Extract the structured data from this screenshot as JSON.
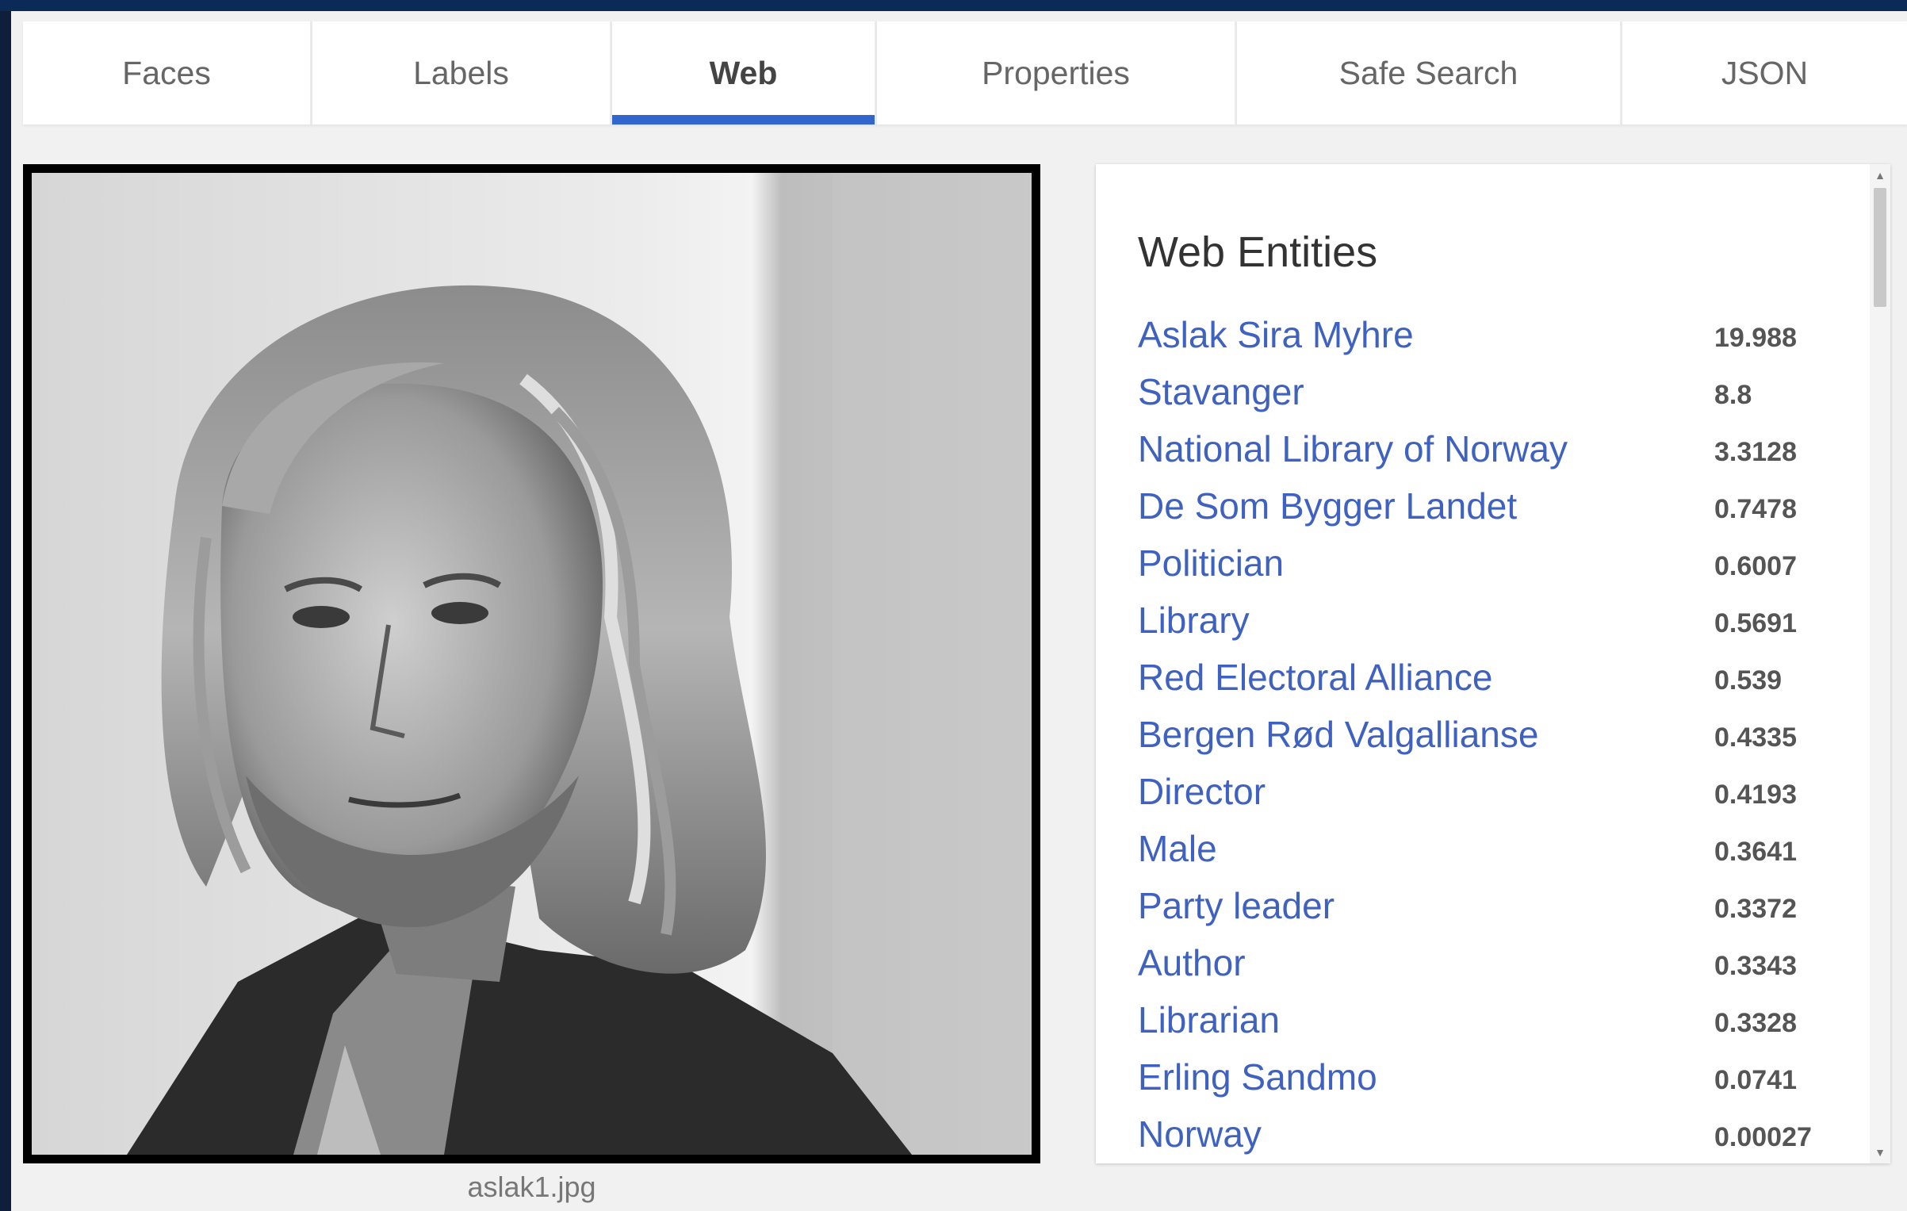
{
  "tabs": [
    {
      "label": "Faces",
      "active": false
    },
    {
      "label": "Labels",
      "active": false
    },
    {
      "label": "Web",
      "active": true
    },
    {
      "label": "Properties",
      "active": false
    },
    {
      "label": "Safe Search",
      "active": false
    },
    {
      "label": "JSON",
      "active": false
    }
  ],
  "image": {
    "caption": "aslak1.jpg"
  },
  "web_entities": {
    "title": "Web Entities",
    "items": [
      {
        "name": "Aslak Sira Myhre",
        "score": "19.988"
      },
      {
        "name": "Stavanger",
        "score": "8.8"
      },
      {
        "name": "National Library of Norway",
        "score": "3.3128"
      },
      {
        "name": "De Som Bygger Landet",
        "score": "0.7478"
      },
      {
        "name": "Politician",
        "score": "0.6007"
      },
      {
        "name": "Library",
        "score": "0.5691"
      },
      {
        "name": "Red Electoral Alliance",
        "score": "0.539"
      },
      {
        "name": "Bergen Rød Valgallianse",
        "score": "0.4335"
      },
      {
        "name": "Director",
        "score": "0.4193"
      },
      {
        "name": "Male",
        "score": "0.3641"
      },
      {
        "name": "Party leader",
        "score": "0.3372"
      },
      {
        "name": "Author",
        "score": "0.3343"
      },
      {
        "name": "Librarian",
        "score": "0.3328"
      },
      {
        "name": "Erling Sandmo",
        "score": "0.0741"
      },
      {
        "name": "Norway",
        "score": "0.00027"
      }
    ]
  },
  "colors": {
    "accent": "#3366cc",
    "link": "#3f62c1",
    "frame_bg": "#0c2a57"
  }
}
